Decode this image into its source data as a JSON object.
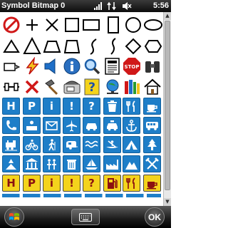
{
  "status_bar": {
    "title": "Symbol Bitmap 0",
    "time": "5:56",
    "icons": [
      "windows-flag-icon",
      "signal-icon",
      "data-arrows-icon",
      "volume-muted-icon"
    ]
  },
  "symbols": {
    "outline_rows": [
      [
        "prohibited-circle-icon",
        "plus-icon",
        "x-cross-icon",
        "square-outline-icon",
        "rectangle-outline-icon",
        "tall-rectangle-outline-icon",
        "circle-outline-icon",
        "ellipse-outline-icon"
      ],
      [
        "triangle-outline-icon",
        "triangle-outline-large-icon",
        "trapezoid-outline-icon",
        "hook-curve-icon",
        "s-curve-icon",
        "diamond-outline-icon",
        "hexagon-outline-icon"
      ],
      [
        "eraser-icon",
        "lightning-icon",
        "speaker-icon",
        "info-circle-icon",
        "magnifier-icon",
        "newspaper-icon",
        "stop-sign-icon",
        "binoculars-icon"
      ],
      [
        "track-segment-icon",
        "red-x-icon",
        "hammer-icon",
        "telephone-fax-icon",
        "help-note-icon",
        "globe-network-icon",
        "books-icon",
        "home-icon"
      ]
    ],
    "tile_rows": [
      [
        "H",
        "P",
        "i",
        "!",
        "?",
        "waste-bin-icon",
        "fork-knife-icon",
        "coffee-cup-icon"
      ],
      [
        "phone-icon",
        "info-desk-icon",
        "mail-icon",
        "airplane-icon",
        "car-icon",
        "taxi-icon",
        "anchor-icon",
        "bus-icon"
      ],
      [
        "train-icon",
        "bicycle-icon",
        "hiker-icon",
        "caravan-icon",
        "water-waves-icon",
        "canoe-icon",
        "tent-icon",
        "pine-tree-icon"
      ],
      [
        "trail-icon",
        "museum-icon",
        "figures-icon",
        "trash-can-icon",
        "boat-icon",
        "factory-icon",
        "mountain-peak-icon",
        "crossed-tools-icon"
      ],
      [
        "H",
        "P",
        "i",
        "!",
        "?",
        "gas-pump-icon",
        "fork-knife-icon",
        "coffee-cup-icon"
      ]
    ]
  },
  "colors": {
    "tile_blue": "#1e7ec8",
    "tile_yellow": "#f4d31c",
    "tile_yellow_text": "#8b1010",
    "icon_red": "#d01818"
  },
  "bottom_bar": {
    "ok_label": "OK"
  }
}
